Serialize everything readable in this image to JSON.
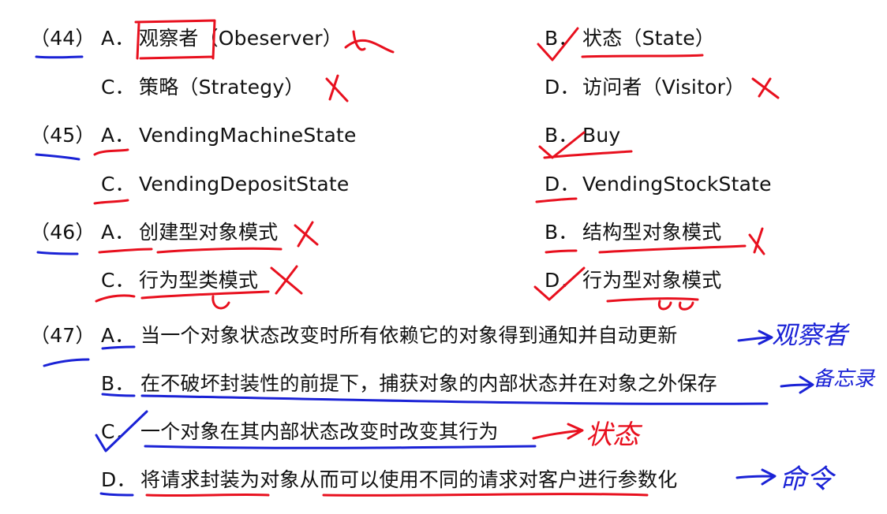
{
  "questions": [
    {
      "number": "（44）",
      "options": [
        {
          "letter": "A．",
          "text": "观察者（Obeserver）"
        },
        {
          "letter": "B．",
          "text": "状态（State）"
        },
        {
          "letter": "C．",
          "text": "策略（Strategy）"
        },
        {
          "letter": "D．",
          "text": "访问者（Visitor）"
        }
      ]
    },
    {
      "number": "（45）",
      "options": [
        {
          "letter": "A．",
          "text": "VendingMachineState"
        },
        {
          "letter": "B．",
          "text": "Buy"
        },
        {
          "letter": "C．",
          "text": "VendingDepositState"
        },
        {
          "letter": "D．",
          "text": "VendingStockState"
        }
      ]
    },
    {
      "number": "（46）",
      "options": [
        {
          "letter": "A．",
          "text": "创建型对象模式"
        },
        {
          "letter": "B．",
          "text": "结构型对象模式"
        },
        {
          "letter": "C．",
          "text": "行为型类模式"
        },
        {
          "letter": "D．",
          "text": "行为型对象模式"
        }
      ]
    },
    {
      "number": "（47）",
      "options": [
        {
          "letter": "A．",
          "text": "当一个对象状态改变时所有依赖它的对象得到通知并自动更新"
        },
        {
          "letter": "B．",
          "text": "在不破坏封装性的前提下，捕获对象的内部状态并在对象之外保存"
        },
        {
          "letter": "C．",
          "text": "一个对象在其内部状态改变时改变其行为"
        },
        {
          "letter": "D．",
          "text": "将请求封装为对象从而可以使用不同的请求对客户进行参数化"
        }
      ]
    }
  ],
  "annotations": {
    "q47_a": "观察者",
    "q47_b": "备忘录",
    "q47_c": "状态",
    "q47_d": "命令"
  },
  "colors": {
    "text": "#111111",
    "red_ink": "#e8101e",
    "blue_ink": "#1a22d6"
  }
}
